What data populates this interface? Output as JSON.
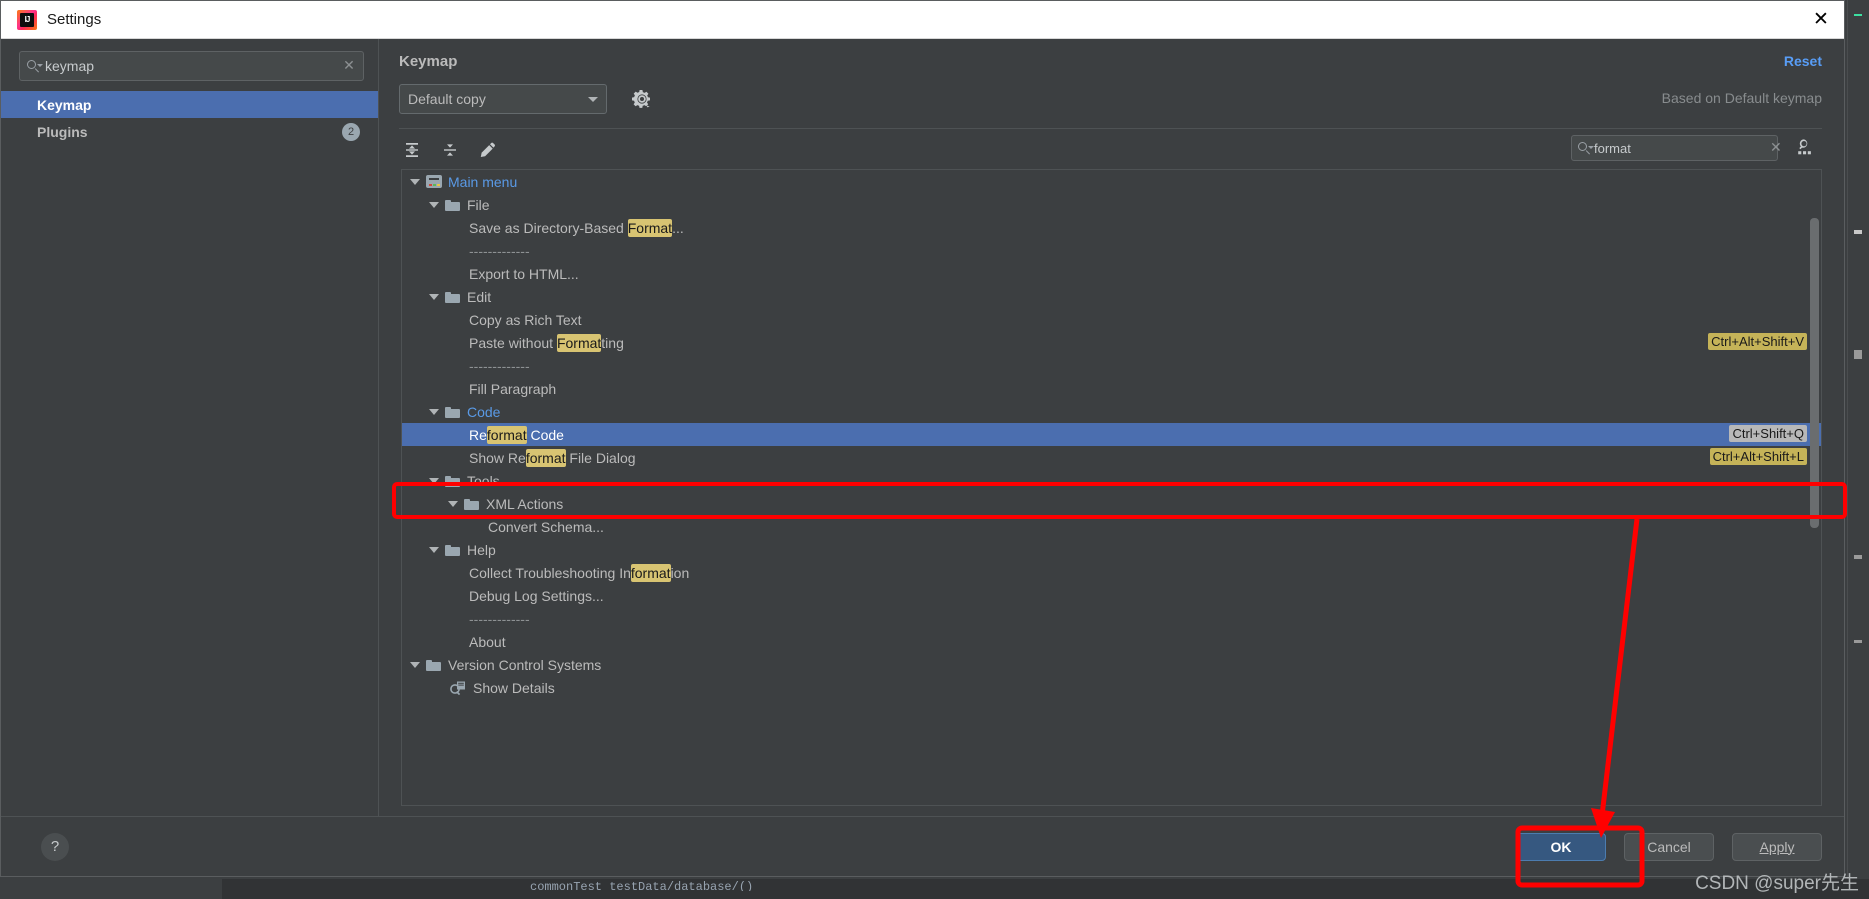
{
  "window": {
    "title": "Settings",
    "app_icon": "intellij-idea-icon",
    "close_label": "✕"
  },
  "sidebar": {
    "search": {
      "value": "keymap",
      "placeholder": "",
      "icon": "search-icon",
      "clear_icon": "clear-icon"
    },
    "items": [
      {
        "label": "Keymap",
        "selected": true,
        "badge": ""
      },
      {
        "label": "Plugins",
        "selected": false,
        "badge": "2"
      }
    ]
  },
  "main": {
    "page_title": "Keymap",
    "reset_label": "Reset",
    "keymap_select": {
      "value": "Default copy"
    },
    "gear_icon": "gear-icon",
    "based_on": "Based on Default keymap",
    "toolbar": {
      "expand_all_icon": "expand-all-icon",
      "collapse_all_icon": "collapse-all-icon",
      "edit_icon": "edit-pencil-icon",
      "search": {
        "value": "format",
        "placeholder": "",
        "icon": "search-icon",
        "clear_icon": "clear-icon"
      },
      "find_shortcut_icon": "find-by-shortcut-icon"
    }
  },
  "tree": [
    {
      "id": 0,
      "indent": 0,
      "text": "Main menu",
      "icon": "main-menu-icon",
      "twisty": true,
      "blue": true,
      "selected": false,
      "shortcut": "",
      "highlight": null
    },
    {
      "id": 1,
      "indent": 1,
      "text": "File",
      "icon": "folder-icon",
      "twisty": true,
      "blue": false,
      "selected": false,
      "shortcut": "",
      "highlight": null
    },
    {
      "id": 2,
      "indent": 2,
      "text": "Save as Directory-Based Format...",
      "icon": "",
      "twisty": false,
      "blue": false,
      "selected": false,
      "shortcut": "",
      "highlight": {
        "start": 24,
        "end": 30
      }
    },
    {
      "id": 3,
      "indent": 2,
      "text": "-------------",
      "icon": "",
      "twisty": false,
      "blue": false,
      "selected": false,
      "shortcut": "",
      "highlight": null,
      "separator": true
    },
    {
      "id": 4,
      "indent": 2,
      "text": "Export to HTML...",
      "icon": "",
      "twisty": false,
      "blue": false,
      "selected": false,
      "shortcut": "",
      "highlight": null
    },
    {
      "id": 5,
      "indent": 1,
      "text": "Edit",
      "icon": "folder-icon",
      "twisty": true,
      "blue": false,
      "selected": false,
      "shortcut": "",
      "highlight": null
    },
    {
      "id": 6,
      "indent": 2,
      "text": "Copy as Rich Text",
      "icon": "",
      "twisty": false,
      "blue": false,
      "selected": false,
      "shortcut": "",
      "highlight": null
    },
    {
      "id": 7,
      "indent": 2,
      "text": "Paste without Formatting",
      "icon": "",
      "twisty": false,
      "blue": false,
      "selected": false,
      "shortcut": "Ctrl+Alt+Shift+V",
      "highlight": {
        "start": 14,
        "end": 20
      }
    },
    {
      "id": 8,
      "indent": 2,
      "text": "-------------",
      "icon": "",
      "twisty": false,
      "blue": false,
      "selected": false,
      "shortcut": "",
      "highlight": null,
      "separator": true
    },
    {
      "id": 9,
      "indent": 2,
      "text": "Fill Paragraph",
      "icon": "",
      "twisty": false,
      "blue": false,
      "selected": false,
      "shortcut": "",
      "highlight": null
    },
    {
      "id": 10,
      "indent": 1,
      "text": "Code",
      "icon": "folder-icon",
      "twisty": true,
      "blue": true,
      "selected": false,
      "shortcut": "",
      "highlight": null
    },
    {
      "id": 11,
      "indent": 2,
      "text": "Reformat Code",
      "icon": "",
      "twisty": false,
      "blue": false,
      "selected": true,
      "shortcut": "Ctrl+Shift+Q",
      "highlight": {
        "start": 2,
        "end": 8
      }
    },
    {
      "id": 12,
      "indent": 2,
      "text": "Show Reformat File Dialog",
      "icon": "",
      "twisty": false,
      "blue": false,
      "selected": false,
      "shortcut": "Ctrl+Alt+Shift+L",
      "highlight": {
        "start": 7,
        "end": 13
      }
    },
    {
      "id": 13,
      "indent": 1,
      "text": "Tools",
      "icon": "folder-icon",
      "twisty": true,
      "blue": false,
      "selected": false,
      "shortcut": "",
      "highlight": null
    },
    {
      "id": 14,
      "indent": 2,
      "text": "XML Actions",
      "icon": "folder-icon",
      "twisty": true,
      "blue": false,
      "selected": false,
      "shortcut": "",
      "highlight": null
    },
    {
      "id": 15,
      "indent": 3,
      "text": "Convert Schema...",
      "icon": "",
      "twisty": false,
      "blue": false,
      "selected": false,
      "shortcut": "",
      "highlight": null
    },
    {
      "id": 16,
      "indent": 1,
      "text": "Help",
      "icon": "folder-icon",
      "twisty": true,
      "blue": false,
      "selected": false,
      "shortcut": "",
      "highlight": null
    },
    {
      "id": 17,
      "indent": 2,
      "text": "Collect Troubleshooting Information",
      "icon": "",
      "twisty": false,
      "blue": false,
      "selected": false,
      "shortcut": "",
      "highlight": {
        "start": 26,
        "end": 32
      }
    },
    {
      "id": 18,
      "indent": 2,
      "text": "Debug Log Settings...",
      "icon": "",
      "twisty": false,
      "blue": false,
      "selected": false,
      "shortcut": "",
      "highlight": null
    },
    {
      "id": 19,
      "indent": 2,
      "text": "-------------",
      "icon": "",
      "twisty": false,
      "blue": false,
      "selected": false,
      "shortcut": "",
      "highlight": null,
      "separator": true
    },
    {
      "id": 20,
      "indent": 2,
      "text": "About",
      "icon": "",
      "twisty": false,
      "blue": false,
      "selected": false,
      "shortcut": "",
      "highlight": null
    },
    {
      "id": 21,
      "indent": 0,
      "text": "Version Control Systems",
      "icon": "folder-icon",
      "twisty": true,
      "blue": false,
      "selected": false,
      "shortcut": "",
      "highlight": null
    },
    {
      "id": 22,
      "indent": 1,
      "text": "Show Details",
      "icon": "vcs-details-icon",
      "twisty": false,
      "blue": false,
      "selected": false,
      "shortcut": "",
      "highlight": null
    }
  ],
  "footer": {
    "help_label": "?",
    "ok_label": "OK",
    "cancel_label": "Cancel",
    "apply_label": "Apply"
  },
  "annotations": {
    "watermark": "CSDN @super先生",
    "accent_red": "#ff0000",
    "highlight_yellow": "#d8c472",
    "selection_blue": "#4b6eaf",
    "link_blue": "#589df6"
  }
}
